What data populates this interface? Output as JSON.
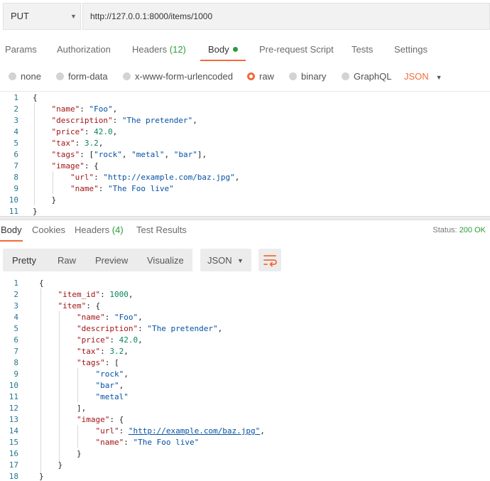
{
  "request": {
    "method": "PUT",
    "url": "http://127.0.0.1:8000/items/1000"
  },
  "request_tabs": {
    "params": "Params",
    "authorization": "Authorization",
    "headers": "Headers",
    "headers_count": "(12)",
    "body": "Body",
    "prerequest": "Pre-request Script",
    "tests": "Tests",
    "settings": "Settings"
  },
  "body_types": {
    "none": "none",
    "form_data": "form-data",
    "urlencoded": "x-www-form-urlencoded",
    "raw": "raw",
    "binary": "binary",
    "graphql": "GraphQL",
    "format": "JSON",
    "selected": "raw"
  },
  "request_body": {
    "line_numbers": [
      "1",
      "2",
      "3",
      "4",
      "5",
      "6",
      "7",
      "8",
      "9",
      "10",
      "11"
    ],
    "lines": [
      "{",
      "    \"name\": \"Foo\",",
      "    \"description\": \"The pretender\",",
      "    \"price\": 42.0,",
      "    \"tax\": 3.2,",
      "    \"tags\": [\"rock\", \"metal\", \"bar\"],",
      "    \"image\": {",
      "        \"url\": \"http://example.com/baz.jpg\",",
      "        \"name\": \"The Foo live\"",
      "    }",
      "}"
    ]
  },
  "response_tabs": {
    "body": "Body",
    "cookies": "Cookies",
    "headers": "Headers",
    "headers_count": "(4)",
    "test_results": "Test Results",
    "status_label": "Status:",
    "status_value": "200 OK"
  },
  "response_view": {
    "pretty": "Pretty",
    "raw": "Raw",
    "preview": "Preview",
    "visualize": "Visualize",
    "format": "JSON"
  },
  "response_body": {
    "line_numbers": [
      "1",
      "2",
      "3",
      "4",
      "5",
      "6",
      "7",
      "8",
      "9",
      "10",
      "11",
      "12",
      "13",
      "14",
      "15",
      "16",
      "17",
      "18"
    ],
    "lines": [
      "{",
      "    \"item_id\": 1000,",
      "    \"item\": {",
      "        \"name\": \"Foo\",",
      "        \"description\": \"The pretender\",",
      "        \"price\": 42.0,",
      "        \"tax\": 3.2,",
      "        \"tags\": [",
      "            \"rock\",",
      "            \"bar\",",
      "            \"metal\"",
      "        ],",
      "        \"image\": {",
      "            \"url\": \"http://example.com/baz.jpg\",",
      "            \"name\": \"The Foo live\"",
      "        }",
      "    }",
      "}"
    ]
  },
  "colors": {
    "accent": "#f26b3a",
    "success": "#2a9d3b",
    "line_number": "#237893",
    "json_key": "#a31515",
    "json_string": "#0451a5",
    "json_number": "#098658"
  },
  "icons": {
    "method_dropdown": "chevron-down-icon",
    "format_dropdown": "chevron-down-icon",
    "wrap": "wrap-lines-icon"
  }
}
